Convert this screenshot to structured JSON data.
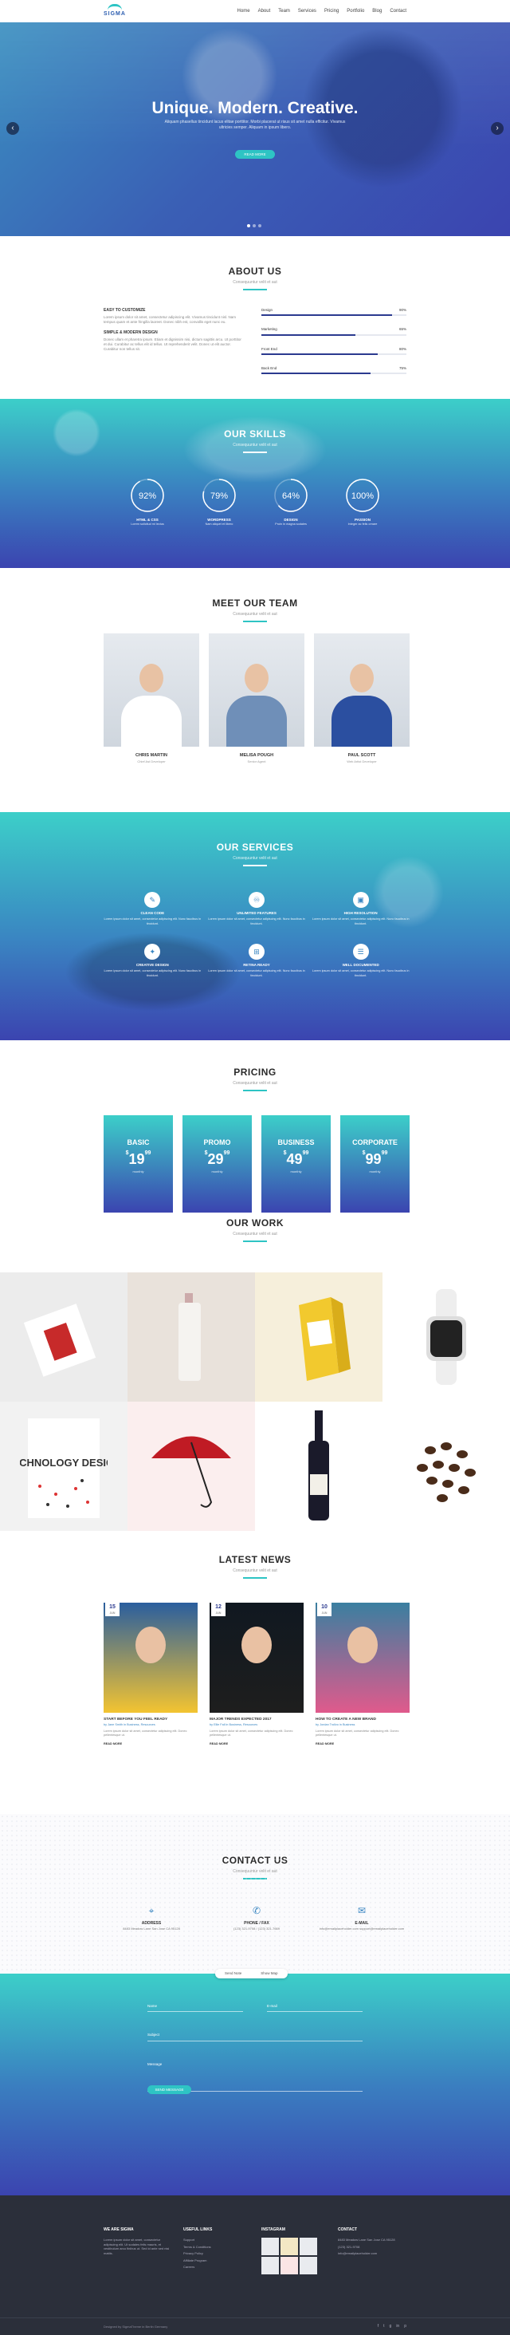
{
  "nav": {
    "logo": "SIGMA",
    "menu": [
      "Home",
      "About",
      "Team",
      "Services",
      "Pricing",
      "Portfolio",
      "Blog",
      "Contact"
    ]
  },
  "hero": {
    "title": "Unique. Modern. Creative.",
    "text": "Aliquam phasellus tincidunt lacus elitae porttitor. Morbi placerat ut risus sit amet nulla efficitur. Vivamus ultricies semper. Aliquam in ipsum libero.",
    "button": "READ MORE"
  },
  "about": {
    "title": "ABOUT US",
    "subtitle": "Consequuntur velit et aut",
    "items": [
      {
        "h": "EASY TO CUSTOMIZE",
        "t": "Lorem ipsum dolor sit amet, consectetur adipiscing elit. Vivamus tincidunt nisl. Nam tempus quam et ante fringilla laoreet. Donec nibh est, convallis eget nunc eu."
      },
      {
        "h": "SIMPLE & MODERN DESIGN",
        "t": "Donec ullam et pharetra ipsum. Etiam et dignissim nisi, dictum sagittis arcu. Ut porttitor et dui. Curabitur ac tellus elit id tellus. Ut reprehenderit velit. Donec ut elit auctor. Curabitur non tellus sit."
      }
    ],
    "bars": [
      {
        "label": "Design",
        "value": "90%",
        "pct": 0.9
      },
      {
        "label": "Marketing",
        "value": "65%",
        "pct": 0.65
      },
      {
        "label": "Front End",
        "value": "80%",
        "pct": 0.8
      },
      {
        "label": "Back End",
        "value": "75%",
        "pct": 0.75
      }
    ]
  },
  "skills": {
    "title": "OUR SKILLS",
    "subtitle": "Consequuntur velit et aut",
    "items": [
      {
        "v": "92%",
        "pct": 0.92,
        "t": "HTML & CSS",
        "s": "Lorem solicitud mi lectus"
      },
      {
        "v": "79%",
        "pct": 0.79,
        "t": "WORDPRESS",
        "s": "Nam aliquet et libero"
      },
      {
        "v": "64%",
        "pct": 0.64,
        "t": "DESIGN",
        "s": "Proin in magna sodales"
      },
      {
        "v": "100%",
        "pct": 1.0,
        "t": "PASSION",
        "s": "Integer ac felis ornare"
      }
    ]
  },
  "team": {
    "title": "MEET OUR TEAM",
    "subtitle": "Consequuntur velit et aut",
    "members": [
      {
        "name": "CHRIS MARTIN",
        "role": "Chief Ast Developer",
        "shirt": "#ffffff"
      },
      {
        "name": "MELISA POUGH",
        "role": "Senior Agent",
        "shirt": "#6f8fb8"
      },
      {
        "name": "PAUL SCOTT",
        "role": "Web Artist Developer",
        "shirt": "#2b4fa0"
      }
    ]
  },
  "services": {
    "title": "OUR SERVICES",
    "subtitle": "Consequuntur velit et aut",
    "items": [
      {
        "icon": "✎",
        "t": "CLEAN CODE",
        "d": "Lorem ipsum dolor sit amet, consectetur adipiscing elit. Nunc faucibus in tincidunt."
      },
      {
        "icon": "♾",
        "t": "UNLIMITED FEATURES",
        "d": "Lorem ipsum dolor sit amet, consectetur adipiscing elit. Nunc faucibus in tincidunt."
      },
      {
        "icon": "▣",
        "t": "HIGH RESOLUTION",
        "d": "Lorem ipsum dolor sit amet, consectetur adipiscing elit. Nunc faucibus in tincidunt."
      },
      {
        "icon": "✦",
        "t": "CREATIVE DESIGN",
        "d": "Lorem ipsum dolor sit amet, consectetur adipiscing elit. Nunc faucibus in tincidunt."
      },
      {
        "icon": "⊞",
        "t": "RETINA READY",
        "d": "Lorem ipsum dolor sit amet, consectetur adipiscing elit. Nunc faucibus in tincidunt."
      },
      {
        "icon": "☰",
        "t": "WELL DOCUMENTED",
        "d": "Lorem ipsum dolor sit amet, consectetur adipiscing elit. Nunc faucibus in tincidunt."
      }
    ]
  },
  "pricing": {
    "title": "PRICING",
    "subtitle": "Consequuntur velit et aut",
    "plans": [
      {
        "name": "BASIC",
        "price": "19",
        "cents": "99",
        "per": "monthly"
      },
      {
        "name": "PROMO",
        "price": "29",
        "cents": "99",
        "per": "monthly"
      },
      {
        "name": "BUSINESS",
        "price": "49",
        "cents": "99",
        "per": "monthly"
      },
      {
        "name": "CORPORATE",
        "price": "99",
        "cents": "99",
        "per": "monthly"
      }
    ]
  },
  "work": {
    "title": "OUR WORK",
    "subtitle": "Consequuntur velit et aut",
    "book_text": "TECHNOLOGY DESIGN"
  },
  "news": {
    "title": "LATEST NEWS",
    "subtitle": "Consequuntur velit et aut",
    "posts": [
      {
        "day": "15",
        "mon": "JUN",
        "t": "START BEFORE YOU FEEL READY",
        "by": "by Jane Smith in Business, Resources",
        "x": "Lorem ipsum dolor sit amet, consectetur adipiscing elit. Donec pellentesque ut.",
        "rm": "READ MORE"
      },
      {
        "day": "12",
        "mon": "JUN",
        "t": "MAJOR TRENDS EXPECTED 2017",
        "by": "by Ellie Fall in Business, Resources",
        "x": "Lorem ipsum dolor sit amet, consectetur adipiscing elit. Donec pellentesque ut.",
        "rm": "READ MORE"
      },
      {
        "day": "10",
        "mon": "JUN",
        "t": "HOW TO CREATE A NEW BRAND",
        "by": "by Jordan Trollvo in Business",
        "x": "Lorem ipsum dolor sit amet, consectetur adipiscing elit. Donec pellentesque ut.",
        "rm": "READ MORE"
      }
    ]
  },
  "contact": {
    "title": "CONTACT US",
    "subtitle": "Consequuntur velit et aut",
    "items": [
      {
        "icon": "⌖",
        "t": "ADDRESS",
        "d": "8483 Meadow Lane San Jose CA 95128"
      },
      {
        "icon": "✆",
        "t": "PHONE / FAX",
        "d": "(123) 321-9708 / (123) 321-7669"
      },
      {
        "icon": "✉",
        "t": "E-MAIL",
        "d": "info@emailplaceholder.com support@emailplaceholder.com"
      }
    ]
  },
  "form": {
    "tabs": [
      "Send Note",
      "Show Map"
    ],
    "name": "Name",
    "email": "E-mail",
    "subject": "Subject",
    "message": "Message",
    "send": "SEND MESSAGE"
  },
  "footer": {
    "c1h": "WE ARE SIGMA",
    "c1t": "Lorem ipsum dolor sit amet, consectetur adipiscing elit. Ut sodales felis mauris, et vestibulum arcu finibus ut. Sed id ante sed nisi mattis.",
    "c2h": "USEFUL LINKS",
    "links": [
      "Support",
      "Terms & Conditions",
      "Privacy Policy",
      "Affiliate Program",
      "Careers"
    ],
    "c3h": "INSTAGRAM",
    "c4h": "CONTACT",
    "contact": [
      "8483 Meadow Lane San Jose CA 95128",
      "(123) 321-9708",
      "info@emailplaceholder.com"
    ],
    "copy": "Designed by SigmaTheme in Berlin Germany",
    "social": [
      "f",
      "t",
      "g",
      "in",
      "p"
    ]
  }
}
